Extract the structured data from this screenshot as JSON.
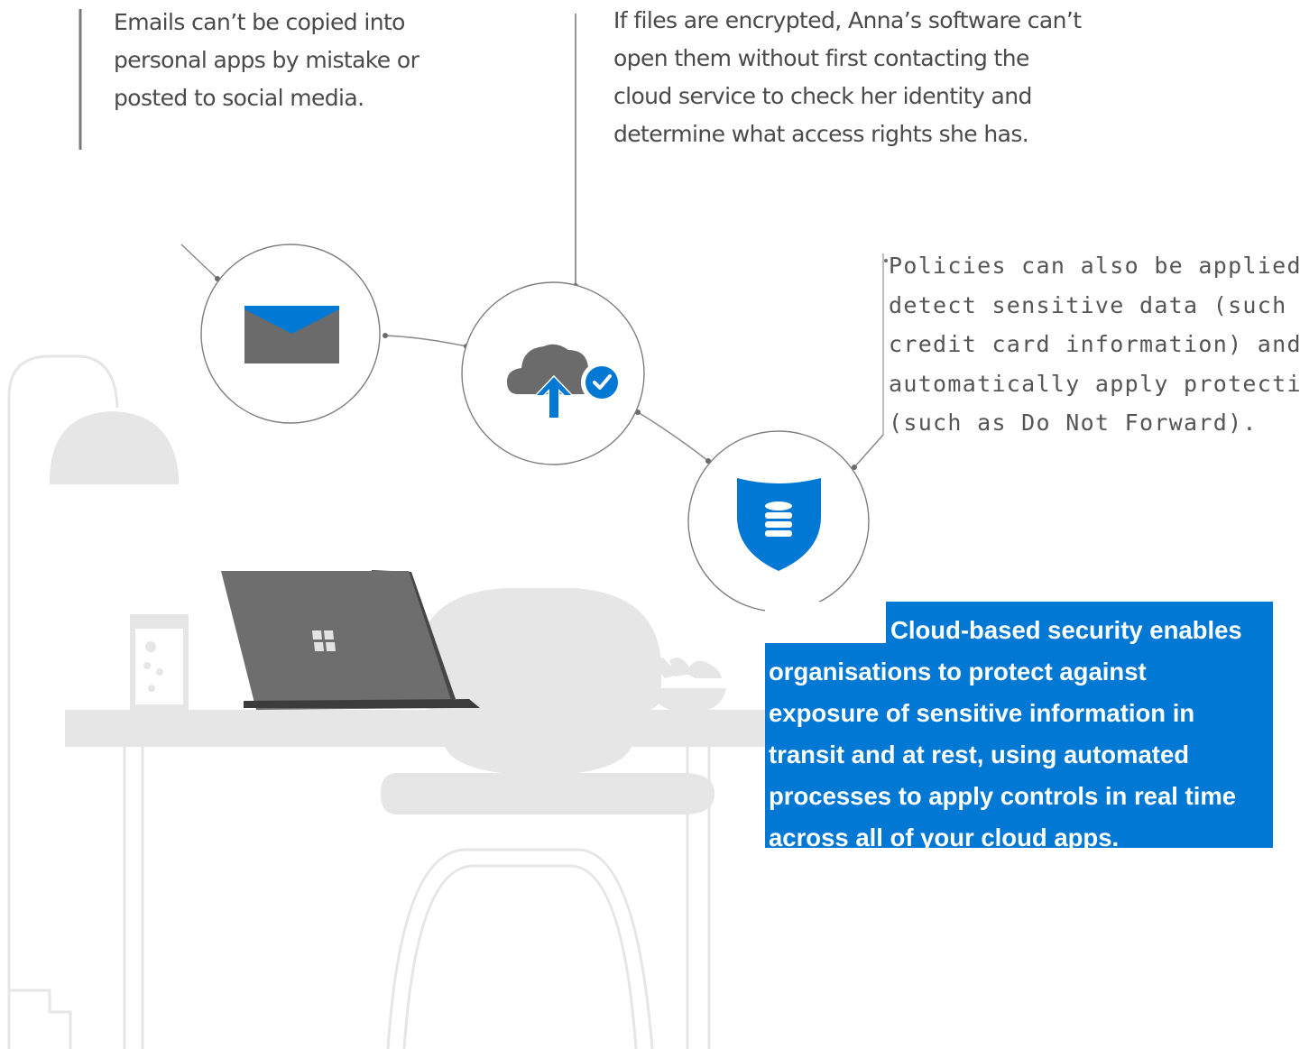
{
  "captions": {
    "email": [
      "Emails can’t be copied into",
      "personal apps by mistake or",
      "posted to social media."
    ],
    "encryption": [
      "If files are encrypted, Anna’s software can’t",
      "open them without first contacting the",
      "cloud service to check her identity and",
      "determine what access rights she has."
    ],
    "policies": [
      "Policies can also be applied to",
      "detect sensitive data (such as",
      "credit card information) and",
      "automatically apply protection",
      "(such as Do Not Forward)."
    ]
  },
  "callout": {
    "lines": [
      "Cloud-based security enables",
      "organisations to protect against",
      "exposure of sensitive information in",
      "transit and at rest, using automated",
      "processes to apply controls in real time",
      "across all of your cloud apps."
    ]
  },
  "icons": {
    "email": "envelope-icon",
    "cloud": "cloud-upload-check-icon",
    "shield": "shield-database-icon"
  },
  "colors": {
    "accent_blue": "#0078d4",
    "icon_gray": "#6b6b6b",
    "furniture_gray": "#e6e6e6",
    "text_gray": "#4a4a4a"
  }
}
